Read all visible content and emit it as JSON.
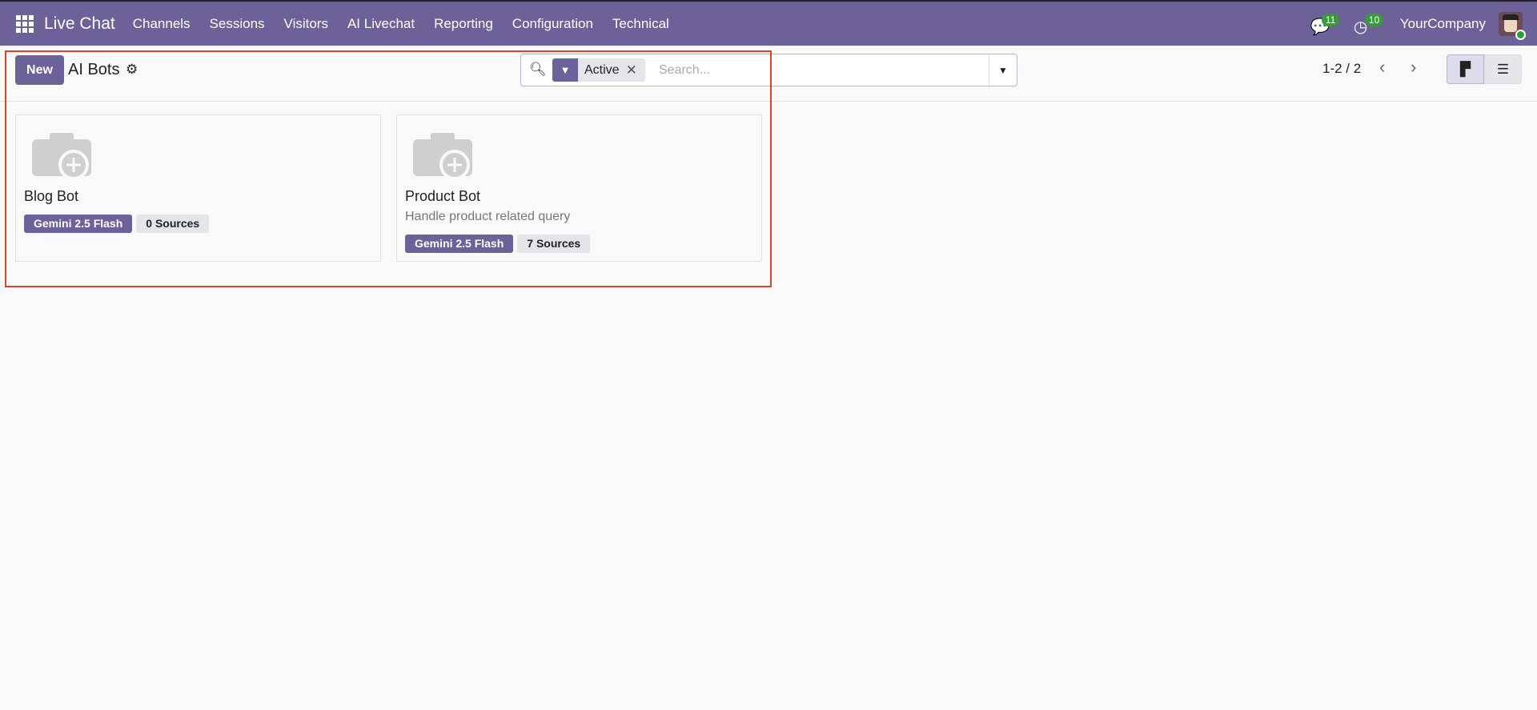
{
  "navbar": {
    "app": "Live Chat",
    "menus": [
      "Channels",
      "Sessions",
      "Visitors",
      "AI Livechat",
      "Reporting",
      "Configuration",
      "Technical"
    ],
    "messages_count": "11",
    "activities_count": "10",
    "company": "YourCompany"
  },
  "control_panel": {
    "new_label": "New",
    "title": "AI Bots",
    "facet": "Active",
    "search_placeholder": "Search...",
    "pager": "1-2 / 2"
  },
  "cards": [
    {
      "name": "Blog Bot",
      "description": "",
      "model": "Gemini 2.5 Flash",
      "sources": "0 Sources"
    },
    {
      "name": "Product Bot",
      "description": "Handle product related query",
      "model": "Gemini 2.5 Flash",
      "sources": "7 Sources"
    }
  ],
  "colors": {
    "brand": "#6c6199",
    "highlight": "#e0402f"
  }
}
